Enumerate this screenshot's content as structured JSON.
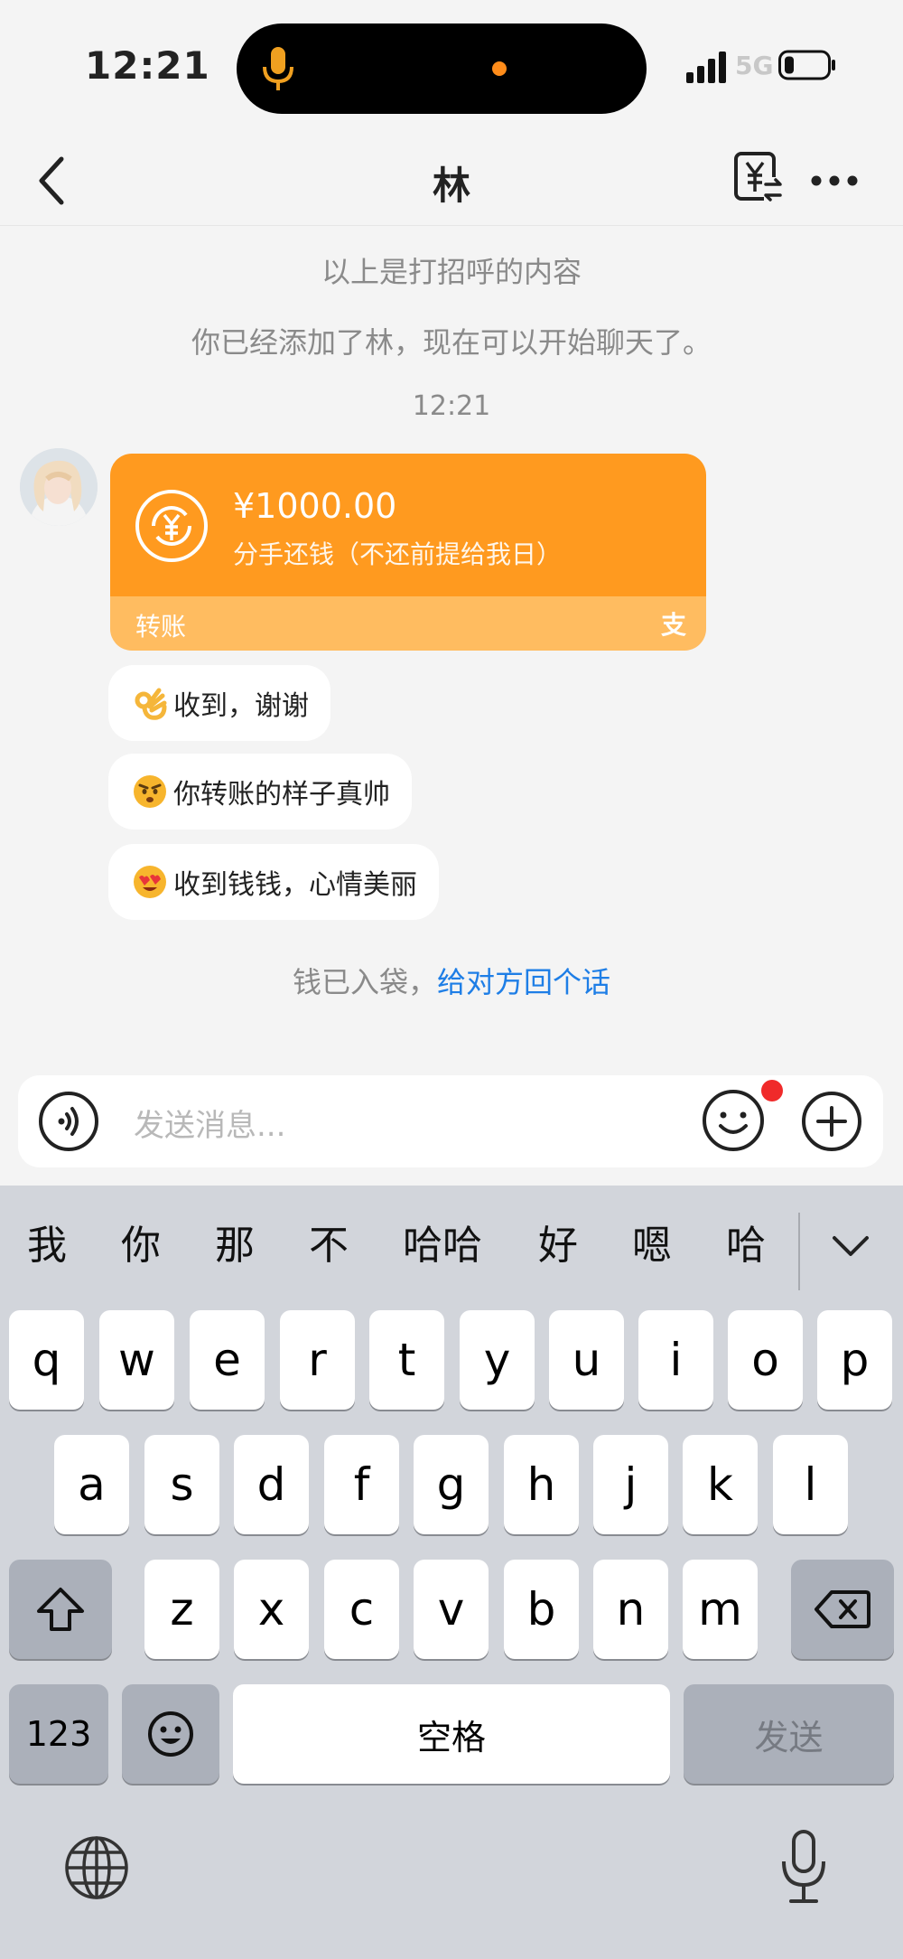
{
  "status": {
    "time": "12:21",
    "network": "5G"
  },
  "header": {
    "title": "林"
  },
  "chat": {
    "system_lines": [
      "以上是打招呼的内容",
      "你已经添加了林，现在可以开始聊天了。"
    ],
    "timestamp": "12:21",
    "transfer": {
      "amount": "¥1000.00",
      "memo": "分手还钱（不还前提给我日）",
      "type": "转账",
      "brand_mark": "支"
    },
    "replies": [
      "收到，谢谢",
      "你转账的样子真帅",
      "收到钱钱，心情美丽"
    ],
    "pocket_notice": {
      "text": "钱已入袋，",
      "link": "给对方回个话"
    }
  },
  "input": {
    "placeholder": "发送消息..."
  },
  "keyboard": {
    "candidates": [
      "我",
      "你",
      "那",
      "不",
      "哈哈",
      "好",
      "嗯",
      "哈"
    ],
    "row1": [
      "q",
      "w",
      "e",
      "r",
      "t",
      "y",
      "u",
      "i",
      "o",
      "p"
    ],
    "row2": [
      "a",
      "s",
      "d",
      "f",
      "g",
      "h",
      "j",
      "k",
      "l"
    ],
    "row3": [
      "z",
      "x",
      "c",
      "v",
      "b",
      "n",
      "m"
    ],
    "numbers_key": "123",
    "space_key": "空格",
    "send_key": "发送"
  },
  "colors": {
    "transfer_card": "#ff9a1f",
    "transfer_card_footer": "#ffbc60",
    "link": "#1e7ee6",
    "badge": "#f02a2a"
  }
}
